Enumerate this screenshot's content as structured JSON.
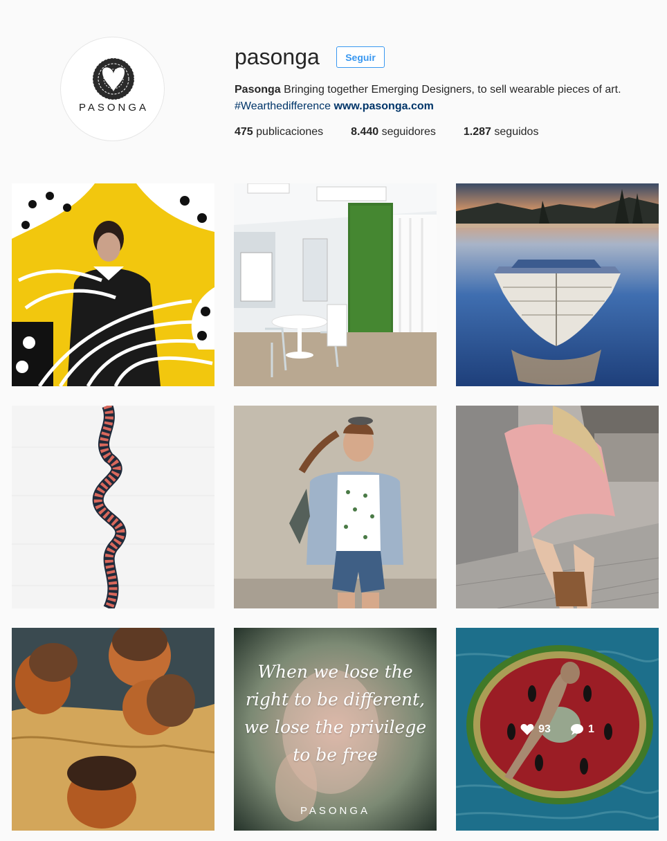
{
  "profile": {
    "username": "pasonga",
    "avatar_text": "PASONGA",
    "follow_label": "Seguir",
    "full_name": "Pasonga",
    "bio_text": "Bringing together Emerging Designers, to sell wearable pieces of art.",
    "hashtag": "#Wearthedifference",
    "website": "www.pasonga.com",
    "stats": {
      "posts_count": "475",
      "posts_label": "publicaciones",
      "followers_count": "8.440",
      "followers_label": "seguidores",
      "following_count": "1.287",
      "following_label": "seguidos"
    }
  },
  "posts": [
    {
      "subject": "woman with tropical leaves"
    },
    {
      "subject": "studio interior with green wall"
    },
    {
      "subject": "rowboat on lake"
    },
    {
      "subject": "striped ribbon"
    },
    {
      "subject": "girl in bomber jacket"
    },
    {
      "subject": "woman in pink coat"
    },
    {
      "subject": "acorns"
    },
    {
      "subject": "quote",
      "quote_lines": [
        "When we lose the",
        "right to be different,",
        "we lose the privilege",
        "to be free"
      ],
      "brand": "PASONGA"
    },
    {
      "subject": "watermelon pool float",
      "likes": "93",
      "comments": "1"
    }
  ],
  "colors": {
    "accent": "#3897f0",
    "link": "#003569",
    "background": "#fafafa"
  }
}
